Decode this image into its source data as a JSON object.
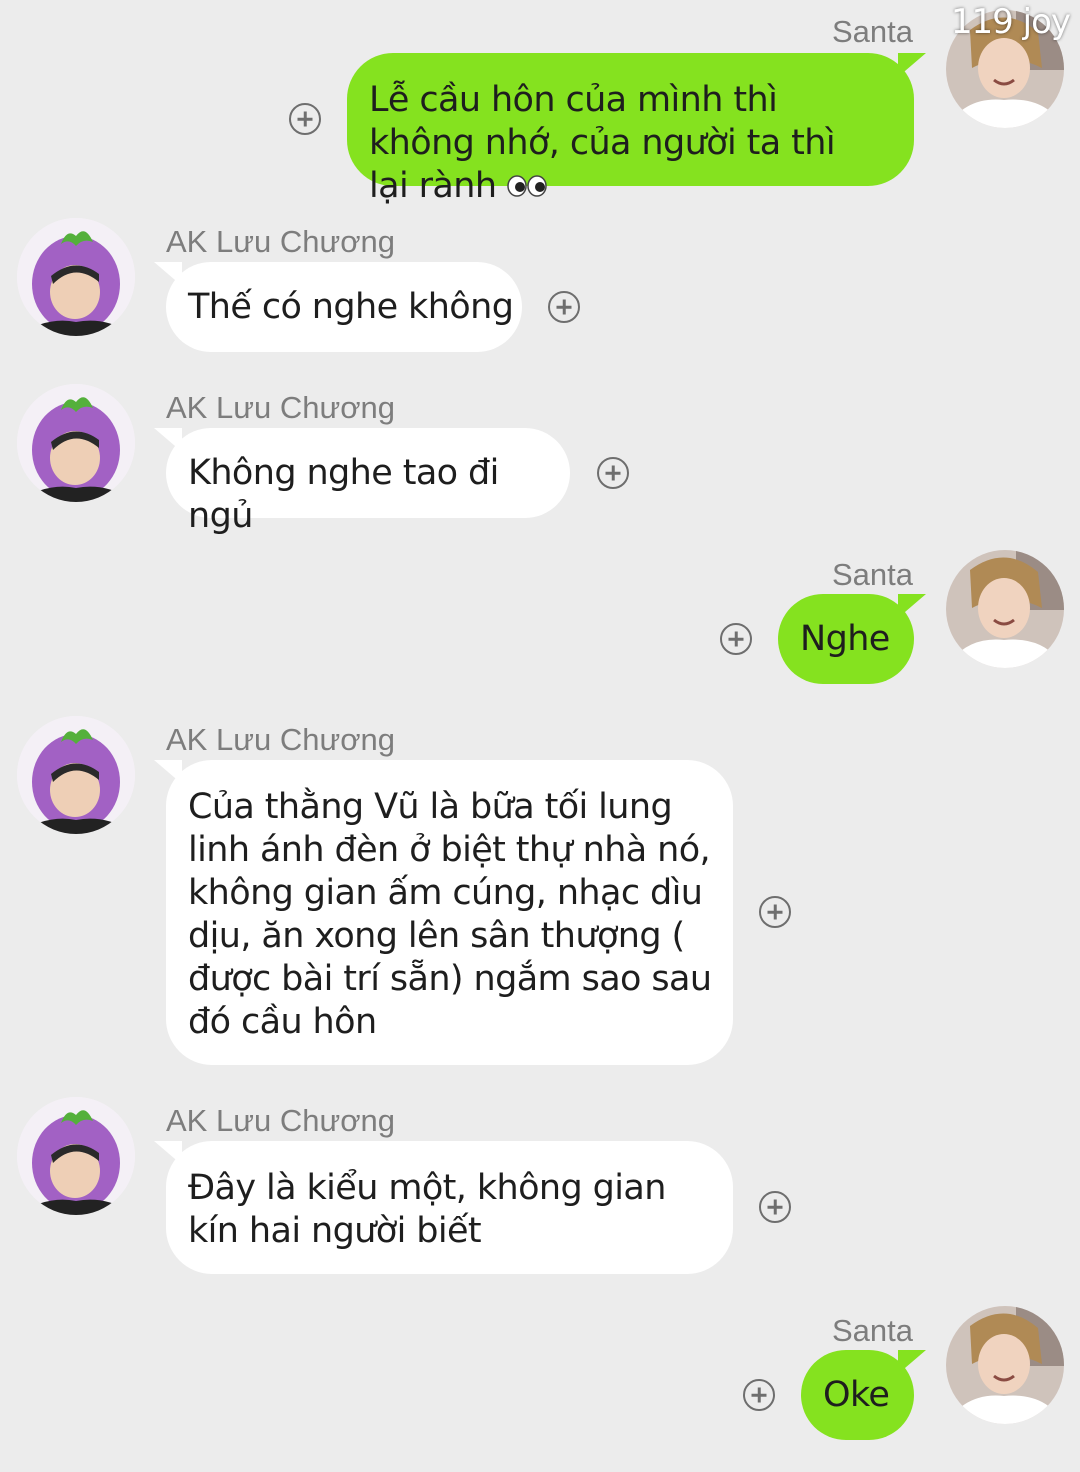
{
  "watermark": "119 joy",
  "messages": [
    {
      "sender": "Santa",
      "text": "Lễ cầu hôn của mình thì không nhớ, của người ta thì lại rành",
      "emoji": "eyes-emoji"
    },
    {
      "sender": "AK Lưu Chương",
      "text": "Thế có nghe không"
    },
    {
      "sender": "AK Lưu Chương",
      "text": "Không nghe tao đi ngủ"
    },
    {
      "sender": "Santa",
      "text": "Nghe"
    },
    {
      "sender": "AK Lưu Chương",
      "text": "Của thằng Vũ là bữa tối lung linh ánh đèn ở biệt thự nhà nó, không gian ấm cúng, nhạc dìu dịu, ăn xong lên sân thượng ( được bài trí sẵn) ngắm sao sau đó cầu hôn"
    },
    {
      "sender": "AK Lưu Chương",
      "text": "Đây là kiểu một, không gian kín hai người biết"
    },
    {
      "sender": "Santa",
      "text": "Oke"
    }
  ],
  "colors": {
    "background": "#ececec",
    "outgoing_bubble": "#85e21f",
    "incoming_bubble": "#ffffff",
    "avatar_eggplant": "#a261c4"
  },
  "icons": {
    "add": "plus-circle-icon",
    "avatar_incoming": "eggplant-hat-avatar",
    "avatar_outgoing": "santa-avatar"
  }
}
